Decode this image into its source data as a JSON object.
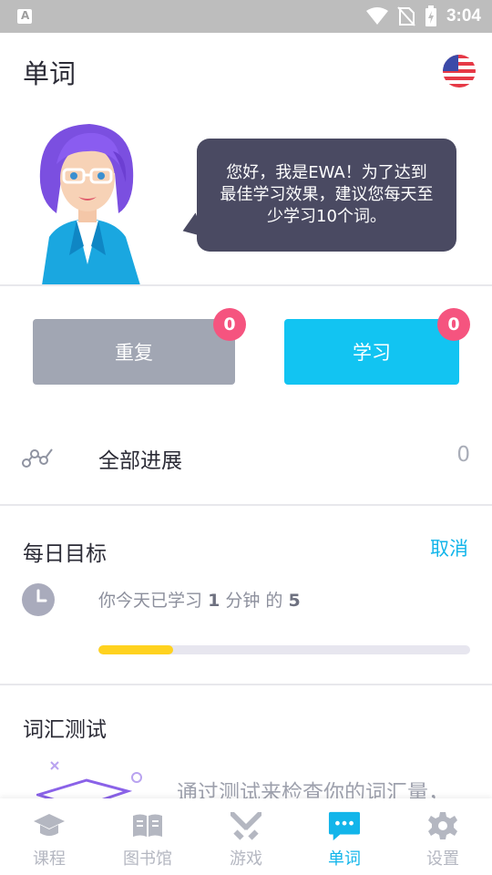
{
  "status_bar": {
    "time": "3:04",
    "notification_icon": "a-letter-icon",
    "icons": [
      "wifi-icon",
      "no-sim-icon",
      "battery-charging-icon"
    ]
  },
  "header": {
    "title": "单词",
    "language_flag_icon": "us-flag-icon"
  },
  "greeting": {
    "mascot_icon": "ewa-mascot-icon",
    "bubble_text": "您好，我是EWA！为了达到最佳学习效果，建议您每天至少学习10个词。"
  },
  "actions": {
    "review": {
      "label": "重复",
      "badge": "0"
    },
    "learn": {
      "label": "学习",
      "badge": "0"
    }
  },
  "progress": {
    "icon": "progress-line-icon",
    "label": "全部进展",
    "value": "0"
  },
  "daily_goal": {
    "title": "每日目标",
    "cancel_label": "取消",
    "text_prefix": "你今天已学习",
    "minutes_done": "1",
    "text_middle": "分钟 的",
    "minutes_goal": "5",
    "progress_fraction": 0.2
  },
  "vocab_test": {
    "title": "词汇测试",
    "description": "通过测试来检查你的词汇量，"
  },
  "bottom_nav": {
    "items": [
      {
        "label": "课程",
        "icon": "graduation-cap-icon",
        "active": false
      },
      {
        "label": "图书馆",
        "icon": "book-icon",
        "active": false
      },
      {
        "label": "游戏",
        "icon": "crossed-swords-icon",
        "active": false
      },
      {
        "label": "单词",
        "icon": "chat-bubble-icon",
        "active": true
      },
      {
        "label": "设置",
        "icon": "gear-icon",
        "active": false
      }
    ]
  },
  "colors": {
    "accent": "#12c4f2",
    "badge": "#f5547f",
    "review_button": "#a1a6b3",
    "goal_fill": "#ffd21f",
    "bubble": "#4a4a62"
  }
}
